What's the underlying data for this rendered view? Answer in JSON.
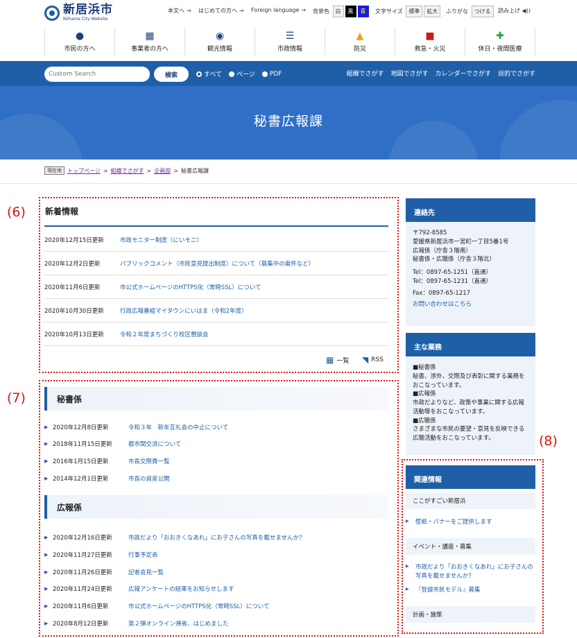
{
  "header": {
    "logo_ja": "新居浜市",
    "logo_en": "Niihama City Website",
    "util_links": [
      "本文へ",
      "はじめての方へ",
      "Foreign language"
    ],
    "bg_label": "背景色",
    "bg_options": [
      "白",
      "黒",
      "青"
    ],
    "fontsize_label": "文字サイズ",
    "fontsize_options": [
      "標準",
      "拡大"
    ],
    "furigana_label": "ふりがな",
    "furigana_option": "つける",
    "readaloud_label": "読み上げ"
  },
  "gnav": [
    {
      "label": "市民の方へ",
      "icon": "person-icon"
    },
    {
      "label": "事業者の方へ",
      "icon": "building-icon"
    },
    {
      "label": "観光情報",
      "icon": "map-pin-icon"
    },
    {
      "label": "市政情報",
      "icon": "list-icon"
    },
    {
      "label": "防災",
      "icon": "helmet-icon"
    },
    {
      "label": "救急・火災",
      "icon": "ambulance-icon"
    },
    {
      "label": "休日・夜間医療",
      "icon": "medical-icon"
    }
  ],
  "search": {
    "placeholder": "Custom Search",
    "button": "検索",
    "radios": [
      "すべて",
      "ページ",
      "PDF"
    ],
    "links": [
      "組織でさがす",
      "地図でさがす",
      "カレンダーでさがす",
      "目的でさがす"
    ]
  },
  "hero": {
    "title": "秘書広報課"
  },
  "breadcrumb": {
    "tag": "現在地",
    "items": [
      "トップページ",
      "組織でさがす",
      "企画部"
    ],
    "current": "秘書広報課"
  },
  "markers": [
    "(6)",
    "(7)",
    "(8)"
  ],
  "news": {
    "title": "新着情報",
    "items": [
      {
        "date": "2020年12月15日更新",
        "text": "市政モニター制度（にいモニ）"
      },
      {
        "date": "2020年12月2日更新",
        "text": "パブリックコメント（市民意見提出制度）について（募集中の案件など）"
      },
      {
        "date": "2020年11月6日更新",
        "text": "市公式ホームページのHTTPS化（常時SSL）について"
      },
      {
        "date": "2020年10月30日更新",
        "text": "行政広報番組マイタウンにいはま（令和2年度）"
      },
      {
        "date": "2020年10月13日更新",
        "text": "令和２年度まちづくり校区懇談会"
      }
    ],
    "list_label": "一覧",
    "rss_label": "RSS"
  },
  "hisho": {
    "title": "秘書係",
    "items": [
      {
        "date": "2020年12月8日更新",
        "text": "令和３年　新年互礼会の中止について"
      },
      {
        "date": "2018年11月15日更新",
        "text": "都市間交流について"
      },
      {
        "date": "2016年1月15日更新",
        "text": "市長交際費一覧"
      },
      {
        "date": "2014年12月1日更新",
        "text": "市長の資産公開"
      }
    ]
  },
  "koho": {
    "title": "広報係",
    "items": [
      {
        "date": "2020年12月16日更新",
        "text": "市政だより「おおきくなあれ」にお子さんの写真を載せませんか？"
      },
      {
        "date": "2020年11月27日更新",
        "text": "行事予定表"
      },
      {
        "date": "2020年11月26日更新",
        "text": "記者会見一覧"
      },
      {
        "date": "2020年11月24日更新",
        "text": "広報アンケートの結果をお知らせします"
      },
      {
        "date": "2020年11月6日更新",
        "text": "市公式ホームページのHTTPS化（常時SSL）について"
      },
      {
        "date": "2020年8月12日更新",
        "text": "第２弾オンライン帰省、はじめました"
      }
    ]
  },
  "contact": {
    "title": "連絡先",
    "lines": [
      "〒792-8585",
      "愛媛県新居浜市一宮町一丁目5番1号",
      "広報係（庁舎３階南）",
      "秘書係・広聴係（庁舎３階北）"
    ],
    "tel1": "Tel：0897-65-1251（直通）",
    "tel2": "Tel：0897-65-1231（直通）",
    "fax": "Fax：0897-65-1217",
    "inquiry": "お問い合わせはこちら"
  },
  "duties": {
    "title": "主な業務",
    "lines": [
      "■秘書係",
      "秘書、渉外、交際及び表彰に関する業務をおこなっています。",
      "■広報係",
      "市政だよりなど、政策や事業に関する広報活動等をおこなっています。",
      "■広聴係",
      "さまざまな市民の要望・意見を反映できる広聴活動をおこなっています。"
    ]
  },
  "related": {
    "title": "関連情報",
    "cat1": "ここがすごい新居浜",
    "link1": "壁紙・バナーをご提供します",
    "cat2": "イベント・講座・募集",
    "link2": "市政だより「おおきくなあれ」にお子さんの写真を載せませんか？",
    "link3": "『登録市民モデル』募集",
    "cat3": "計画・施策"
  },
  "colors": {
    "primary": "#1e5fa8",
    "hero": "#2f6fc5",
    "annotation": "#e01010"
  }
}
